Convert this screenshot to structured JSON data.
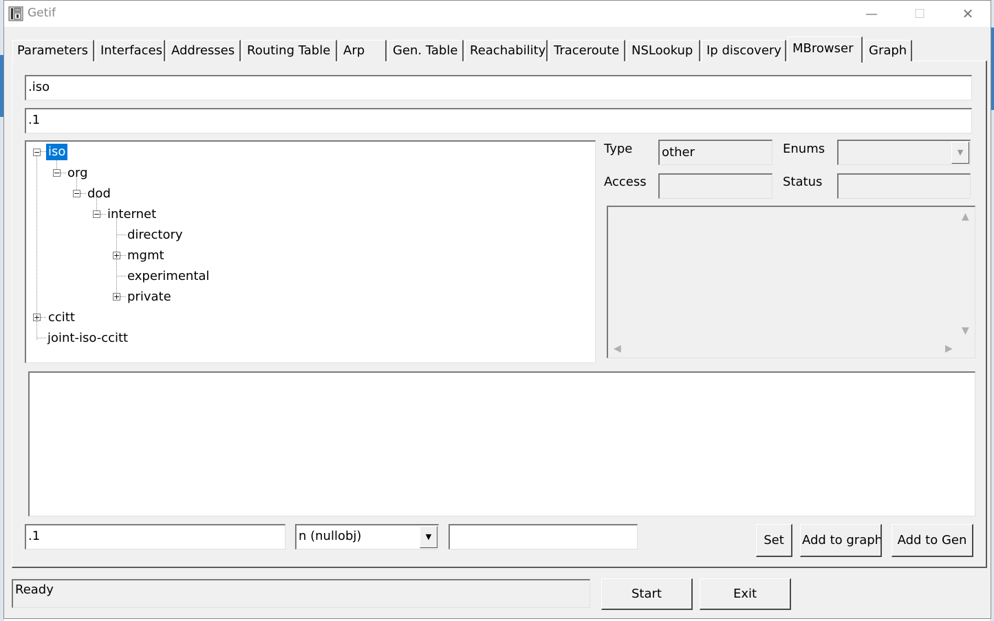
{
  "window": {
    "title": "Getif"
  },
  "titlebar": {
    "minimize": "—",
    "maximize": "☐",
    "close": "✕"
  },
  "tabs": [
    {
      "label": "Parameters"
    },
    {
      "label": "Interfaces"
    },
    {
      "label": "Addresses"
    },
    {
      "label": "Routing Table"
    },
    {
      "label": "Arp"
    },
    {
      "label": "Gen. Table"
    },
    {
      "label": "Reachability"
    },
    {
      "label": "Traceroute"
    },
    {
      "label": "NSLookup"
    },
    {
      "label": "Ip discovery"
    },
    {
      "label": "MBrowser",
      "active": true
    },
    {
      "label": "Graph"
    }
  ],
  "mbrowser": {
    "oid_name": ".iso",
    "oid_number": ".1",
    "tree": {
      "iso": "iso",
      "org": "org",
      "dod": "dod",
      "internet": "internet",
      "directory": "directory",
      "mgmt": "mgmt",
      "experimental": "experimental",
      "private": "private",
      "ccitt": "ccitt",
      "joint": "joint-iso-ccitt"
    },
    "labels": {
      "type": "Type",
      "access": "Access",
      "enums": "Enums",
      "status": "Status"
    },
    "values": {
      "type": "other",
      "access": "",
      "enums": "",
      "status": ""
    },
    "set_oid": ".1",
    "set_type": "n (nullobj)",
    "set_value": "",
    "buttons": {
      "set": "Set",
      "add_graph": "Add to graph",
      "add_gen": "Add to Gen"
    }
  },
  "statusbar": {
    "text": "Ready"
  },
  "footer": {
    "start": "Start",
    "exit": "Exit"
  }
}
